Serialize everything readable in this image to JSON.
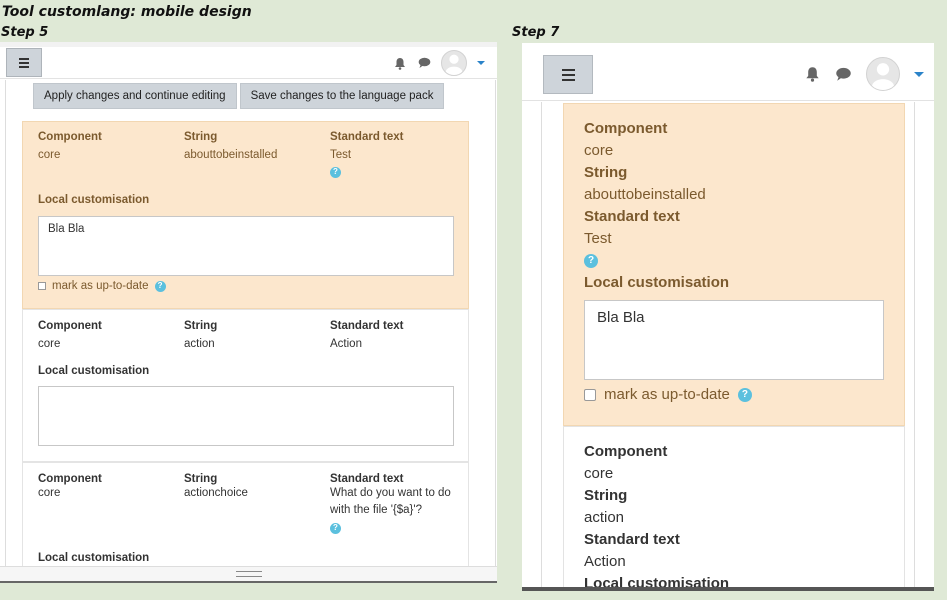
{
  "page": {
    "title": "Tool customlang: mobile design",
    "step5_label": "Step 5",
    "step7_label": "Step 7"
  },
  "toolbar": {
    "apply_label": "Apply changes and continue editing",
    "save_label": "Save changes to the language pack"
  },
  "labels": {
    "component": "Component",
    "string": "String",
    "standard_text": "Standard text",
    "local_customisation": "Local customisation",
    "mark_uptodate": "mark as up-to-date"
  },
  "entries": [
    {
      "component": "core",
      "string": "abouttobeinstalled",
      "standard": "Test",
      "custom": "Bla Bla",
      "highlighted": true
    },
    {
      "component": "core",
      "string": "action",
      "standard": "Action",
      "custom": "",
      "highlighted": false
    },
    {
      "component": "core",
      "string": "actionchoice",
      "standard": "What do you want to do with the file '{$a}'?",
      "custom": "",
      "highlighted": false
    }
  ],
  "icons": {
    "menu": "hamburger-icon",
    "notifications": "bell-icon",
    "messages": "chat-icon",
    "user": "avatar-icon",
    "dropdown": "caret-down-icon",
    "help": "help-icon",
    "resize": "resize-grip-icon"
  },
  "colors": {
    "highlight_bg": "#fce7cd",
    "highlight_text": "#7b5a2e",
    "button_bg": "#ced4da",
    "help_icon": "#5bc0de",
    "caret": "#2b83c9",
    "page_bg": "#dfe9d6"
  }
}
